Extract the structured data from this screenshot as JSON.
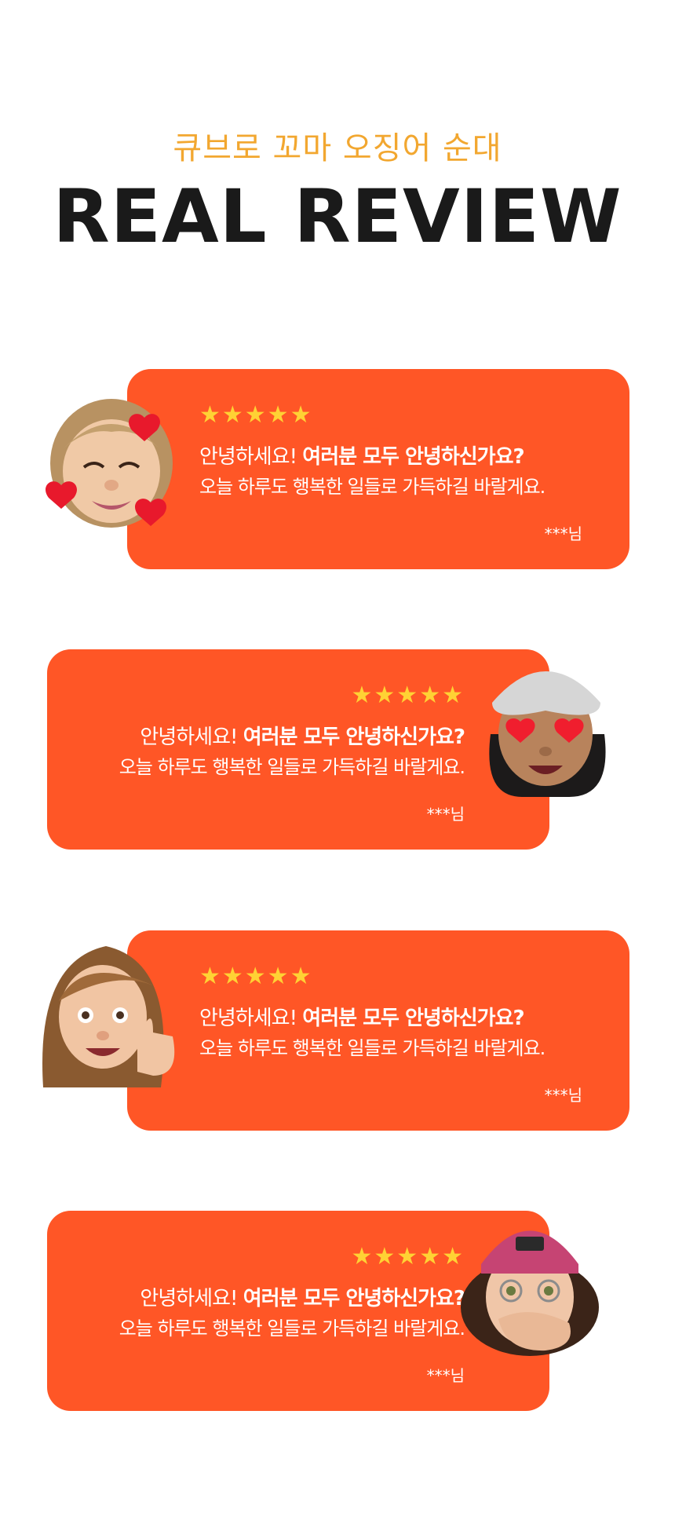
{
  "header": {
    "subtitle": "큐브로 꼬마 오징어 순대",
    "title": "REAL REVIEW"
  },
  "colors": {
    "card": "#ff5626",
    "star": "#ffd234",
    "subtitle": "#f2a730",
    "title": "#1a1a1a"
  },
  "reviews": [
    {
      "stars": "★★★★★",
      "greeting": "안녕하세요!",
      "headline": "여러분 모두 안녕하신가요?",
      "body": "오늘 하루도 행복한 일들로 가득하길 바랄게요.",
      "author": "***님",
      "avatar_icon": "memoji-heart-face-icon"
    },
    {
      "stars": "★★★★★",
      "greeting": "안녕하세요!",
      "headline": "여러분 모두 안녕하신가요?",
      "body": "오늘 하루도 행복한 일들로 가득하길 바랄게요.",
      "author": "***님",
      "avatar_icon": "memoji-heart-eyes-icon"
    },
    {
      "stars": "★★★★★",
      "greeting": "안녕하세요!",
      "headline": "여러분 모두 안녕하신가요?",
      "body": "오늘 하루도 행복한 일들로 가득하길 바랄게요.",
      "author": "***님",
      "avatar_icon": "memoji-thumbs-up-icon"
    },
    {
      "stars": "★★★★★",
      "greeting": "안녕하세요!",
      "headline": "여러분 모두 안녕하신가요?",
      "body": "오늘 하루도 행복한 일들로 가득하길 바랄게요.",
      "author": "***님",
      "avatar_icon": "memoji-hand-over-mouth-icon"
    }
  ]
}
